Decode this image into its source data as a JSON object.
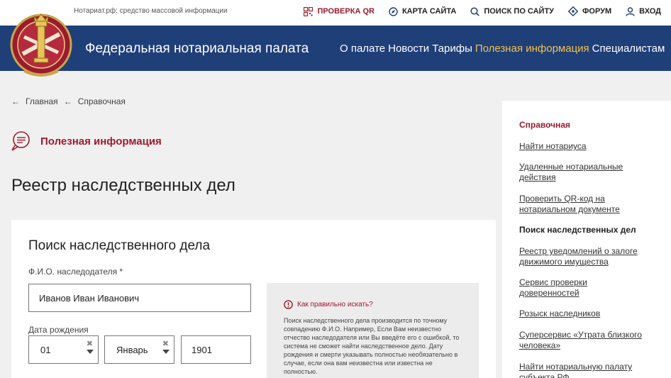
{
  "topbar": {
    "tagline": "Нотариат.рф: средство массовой информации",
    "links": [
      {
        "label": "ПРОВЕРКА QR",
        "icon": "qr-icon"
      },
      {
        "label": "КАРТА САЙТА",
        "icon": "compass-icon"
      },
      {
        "label": "ПОИСК ПО САЙТУ",
        "icon": "search-icon"
      },
      {
        "label": "ФОРУМ",
        "icon": "forum-icon"
      },
      {
        "label": "ВХОД",
        "icon": "user-icon"
      }
    ]
  },
  "header": {
    "title": "Федеральная нотариальная палата",
    "nav": [
      "О палате",
      "Новости",
      "Тарифы",
      "Полезная информация",
      "Специалистам"
    ],
    "active_nav": "Полезная информация"
  },
  "breadcrumb": {
    "arrow": "←",
    "items": [
      "Главная",
      "Справочная"
    ]
  },
  "section": {
    "label": "Полезная информация"
  },
  "page": {
    "title": "Реестр наследственных дел"
  },
  "form": {
    "title": "Поиск наследственного дела",
    "fio_label": "Ф.И.О. наследодателя *",
    "fio_value": "Иванов Иван Иванович",
    "birth_label": "Дата рождения",
    "day": "01",
    "month": "Январь",
    "year": "1901",
    "clear_glyph": "✖"
  },
  "hint": {
    "title": "Как правильно искать?",
    "text": "Поиск наследственного дела производится по точному совпадению Ф.И.О. Например, Если Вам неизвестно отчество наследодателя или Вы введёте его с ошибкой, то система не сможет найти наследственное дело. Дату рождения и смерти указывать полностью необязательно в случае, если она вам неизвестна или известна не полностью."
  },
  "sidebar": {
    "title": "Справочная",
    "items": [
      "Найти нотариуса",
      "Удаленные нотариальные действия",
      "Проверить QR-код на нотариальном документе",
      "Поиск наследственных дел",
      "Реестр уведомлений о залоге движимого имущества",
      "Сервис проверки доверенностей",
      "Розыск наследников",
      "Суперсервис «Утрата близкого человека»",
      "Найти нотариальную палату субъекта РФ"
    ],
    "current": "Поиск наследственных дел"
  },
  "colors": {
    "brand_red": "#9b1b2e",
    "header_blue": "#1f3f79",
    "nav_active": "#f2c14e"
  }
}
